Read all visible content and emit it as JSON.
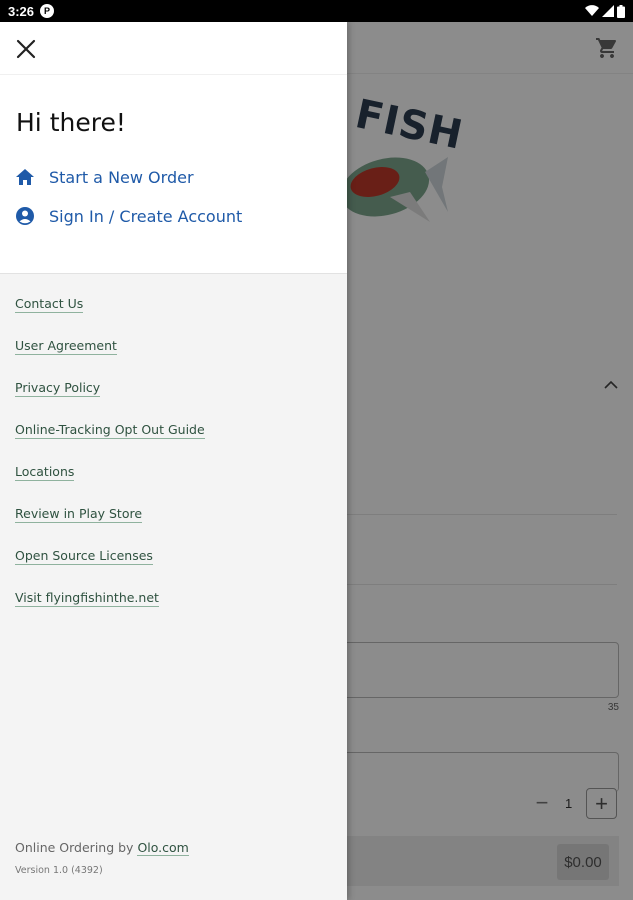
{
  "status_bar": {
    "time": "3:26",
    "app_badge": "P"
  },
  "background": {
    "logo_text": "FISH",
    "char_count": "35",
    "quantity": "1",
    "price": "$0.00"
  },
  "drawer": {
    "greeting": "Hi there!",
    "actions": [
      {
        "label": "Start a New Order",
        "icon": "home-icon"
      },
      {
        "label": "Sign In / Create Account",
        "icon": "account-circle-icon"
      }
    ],
    "links": [
      "Contact Us",
      "User Agreement",
      "Privacy Policy",
      "Online-Tracking Opt Out Guide",
      "Locations",
      "Review in Play Store",
      "Open Source Licenses",
      "Visit flyingfishinthe.net"
    ],
    "footer": {
      "prefix": "Online Ordering by",
      "link": "Olo.com",
      "version": "Version 1.0 (4392)"
    }
  },
  "colors": {
    "accent_blue": "#1f5aa8",
    "link_green": "#2f5240",
    "link_underline": "#8fb29e",
    "drawer_bg": "#f4f4f4"
  }
}
